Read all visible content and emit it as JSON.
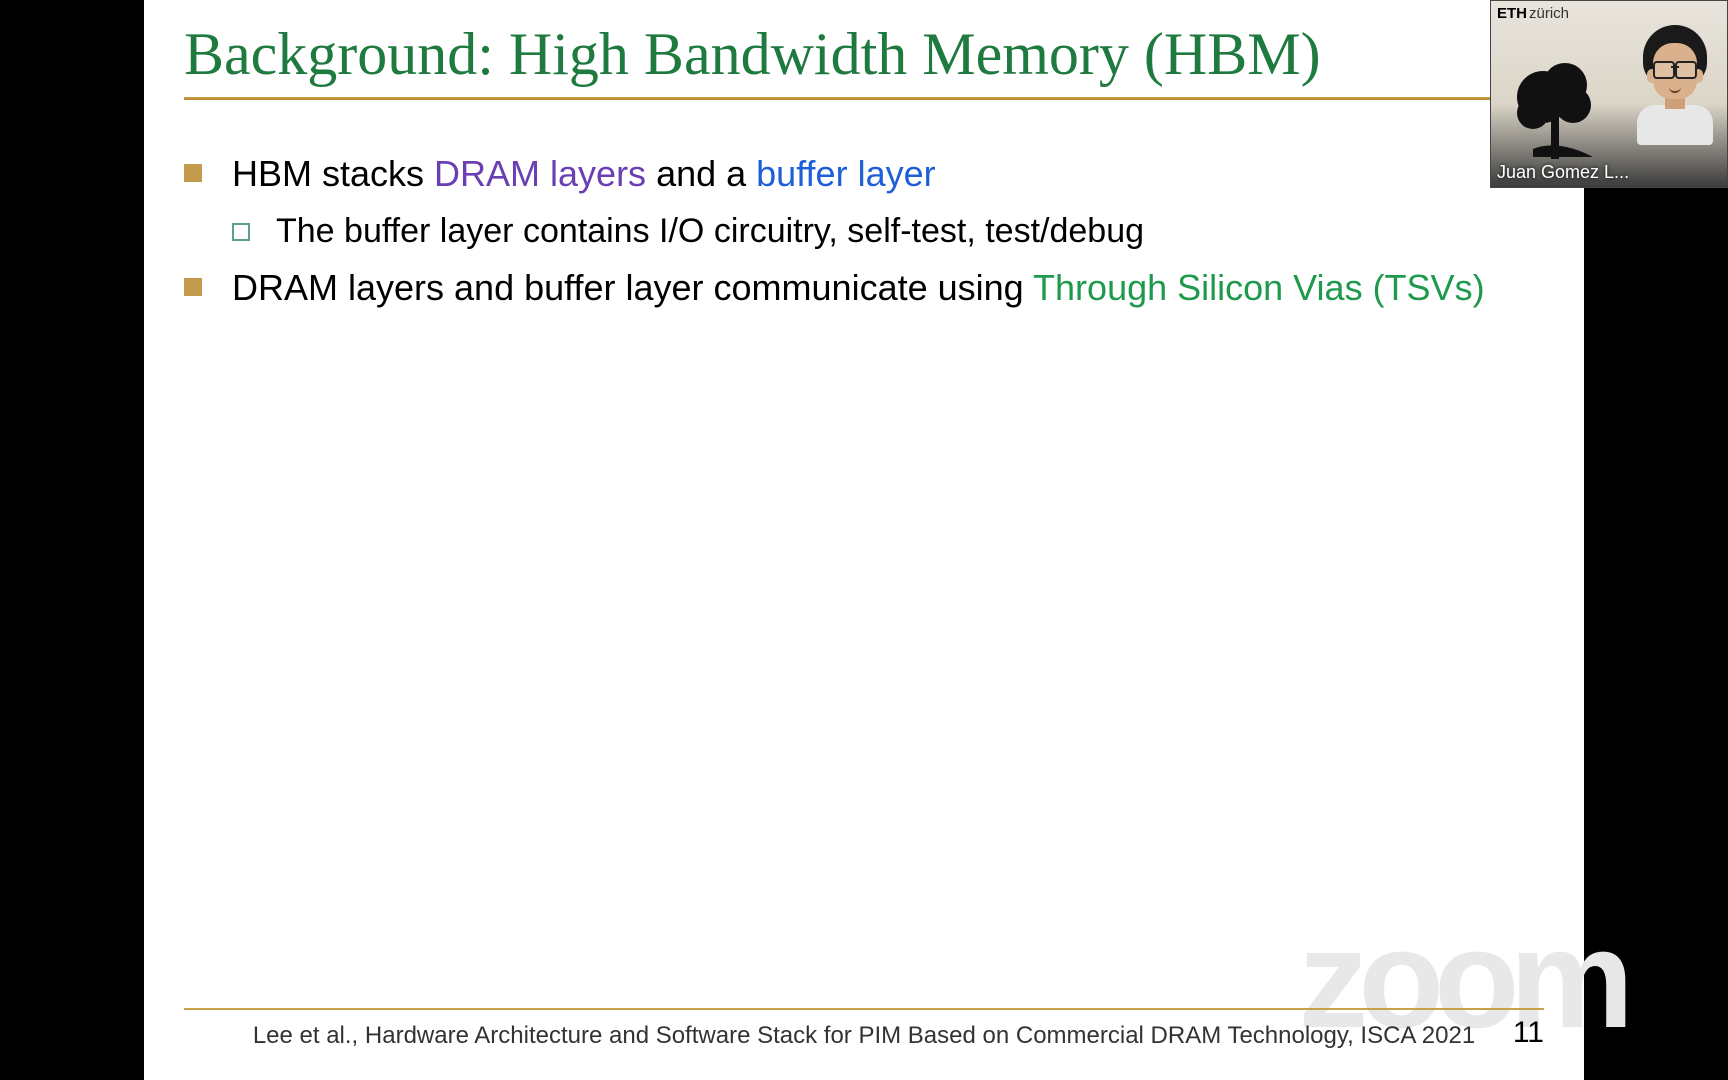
{
  "slide": {
    "title": "Background: High Bandwidth Memory (HBM)",
    "bullets": [
      {
        "segments": [
          {
            "text": "HBM stacks ",
            "cls": ""
          },
          {
            "text": "DRAM layers",
            "cls": "c-purple"
          },
          {
            "text": " and a ",
            "cls": ""
          },
          {
            "text": "buffer layer",
            "cls": "c-blue"
          }
        ],
        "sub": [
          {
            "segments": [
              {
                "text": "The buffer layer contains I/O circuitry, self-test, test/debug",
                "cls": ""
              }
            ]
          }
        ]
      },
      {
        "segments": [
          {
            "text": "DRAM layers and buffer layer communicate using ",
            "cls": ""
          },
          {
            "text": "Through Silicon Vias (TSVs)",
            "cls": "c-green"
          }
        ],
        "sub": []
      }
    ],
    "citation": "Lee et al., Hardware Architecture and Software Stack for PIM Based on Commercial DRAM Technology, ISCA 2021",
    "page_number": "11"
  },
  "watermark": "zoom",
  "speaker": {
    "corner_bold": "ETH",
    "corner_thin": "zürich",
    "name": "Juan Gomez L..."
  }
}
